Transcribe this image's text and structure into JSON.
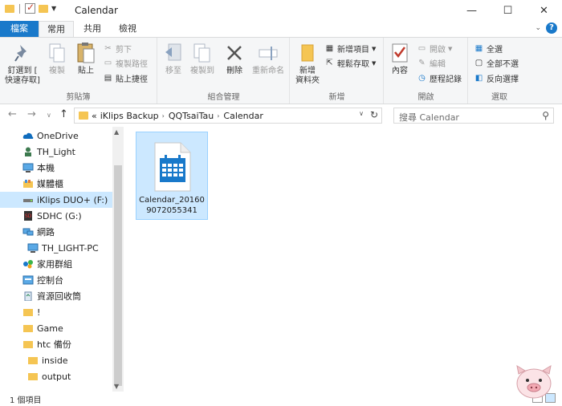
{
  "window": {
    "title": "Calendar"
  },
  "tabs": [
    {
      "label": "檔案"
    },
    {
      "label": "常用"
    },
    {
      "label": "共用"
    },
    {
      "label": "檢視"
    }
  ],
  "ribbon": {
    "clipboard": {
      "label": "剪貼簿",
      "pin": "釘選到 [\n快速存取]",
      "copy": "複製",
      "paste": "貼上",
      "cut": "剪下",
      "copy_path": "複製路徑",
      "paste_shortcut": "貼上捷徑"
    },
    "organize": {
      "label": "組合管理",
      "move_to": "移至",
      "copy_to": "複製到",
      "delete": "刪除",
      "rename": "重新命名"
    },
    "new": {
      "label": "新增",
      "new_folder": "新增\n資料夾",
      "new_item": "新增項目",
      "easy_access": "輕鬆存取"
    },
    "open": {
      "label": "開啟",
      "properties": "內容",
      "open": "開啟",
      "edit": "編輯",
      "history": "歷程記錄"
    },
    "select": {
      "label": "選取",
      "select_all": "全選",
      "select_none": "全部不選",
      "invert": "反向選擇"
    }
  },
  "address": {
    "prefix": "«",
    "crumbs": [
      "iKlips Backup",
      "QQTsaiTau",
      "Calendar"
    ]
  },
  "search": {
    "placeholder": "搜尋 Calendar"
  },
  "nav": [
    {
      "label": "OneDrive",
      "icon": "cloud-icon"
    },
    {
      "label": "TH_Light",
      "icon": "user-icon"
    },
    {
      "label": "本機",
      "icon": "computer-icon"
    },
    {
      "label": "媒體櫃",
      "icon": "library-icon"
    },
    {
      "label": "iKlips DUO+ (F:)",
      "icon": "drive-icon"
    },
    {
      "label": "SDHC (G:)",
      "icon": "sd-card-icon"
    },
    {
      "label": "網路",
      "icon": "network-icon"
    },
    {
      "label": "TH_LIGHT-PC",
      "icon": "pc-icon"
    },
    {
      "label": "家用群組",
      "icon": "homegroup-icon"
    },
    {
      "label": "控制台",
      "icon": "control-panel-icon"
    },
    {
      "label": "資源回收筒",
      "icon": "recycle-bin-icon"
    },
    {
      "label": "!",
      "icon": "folder-icon"
    },
    {
      "label": "Game",
      "icon": "folder-icon"
    },
    {
      "label": "htc 備份",
      "icon": "folder-icon"
    },
    {
      "label": "inside",
      "icon": "folder-icon"
    },
    {
      "label": "output",
      "icon": "folder-icon"
    }
  ],
  "files": [
    {
      "name": "Calendar_20160907205534 1",
      "display": "Calendar_20160\n9072055341",
      "icon": "calendar-file-icon"
    }
  ],
  "status": {
    "count": "1 個項目"
  },
  "colors": {
    "accent": "#1979ca",
    "selection": "#cce8ff",
    "folder": "#f5c553"
  }
}
